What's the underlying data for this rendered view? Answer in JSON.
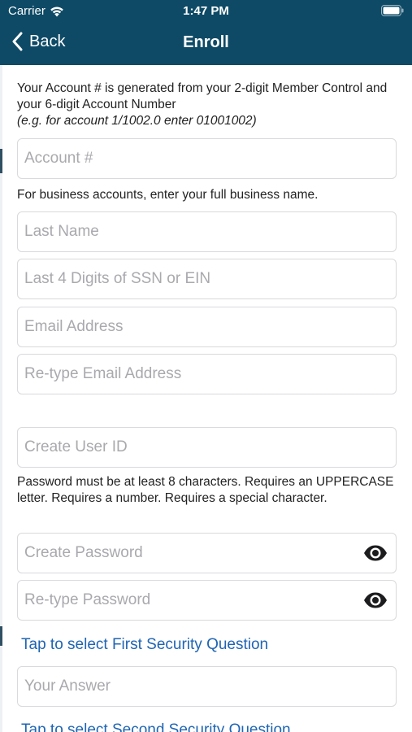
{
  "status": {
    "carrier": "Carrier",
    "time": "1:47 PM"
  },
  "nav": {
    "back_label": "Back",
    "title": "Enroll"
  },
  "account_info": {
    "line1": "Your Account # is generated from your 2-digit Member Control and your 6-digit Account Number",
    "example": "(e.g. for account 1/1002.0 enter 01001002)"
  },
  "fields": {
    "account_number": {
      "placeholder": "Account #",
      "value": ""
    },
    "last_name": {
      "placeholder": "Last Name",
      "value": ""
    },
    "ssn_last4": {
      "placeholder": "Last 4 Digits of SSN or EIN",
      "value": ""
    },
    "email": {
      "placeholder": "Email Address",
      "value": ""
    },
    "email_confirm": {
      "placeholder": "Re-type Email Address",
      "value": ""
    },
    "user_id": {
      "placeholder": "Create User ID",
      "value": ""
    },
    "password": {
      "placeholder": "Create Password",
      "value": ""
    },
    "password_confirm": {
      "placeholder": "Re-type Password",
      "value": ""
    },
    "answer1": {
      "placeholder": "Your Answer",
      "value": ""
    }
  },
  "business_note": "For business accounts, enter your full business name.",
  "password_rules": "Password must be at least 8 characters. Requires an UPPERCASE letter. Requires a number. Requires a special character.",
  "security": {
    "first_question_link": "Tap to select First Security Question",
    "second_question_link": "Tap to select Second Security Question"
  },
  "icons": {
    "wifi": "wifi-icon",
    "battery": "battery-icon",
    "back": "chevron-left-icon",
    "show_password": "eye-icon"
  },
  "colors": {
    "header_bg": "#0e4a66",
    "link": "#1f65b3",
    "placeholder": "#a9a9ae",
    "field_border": "#d9d9de"
  }
}
